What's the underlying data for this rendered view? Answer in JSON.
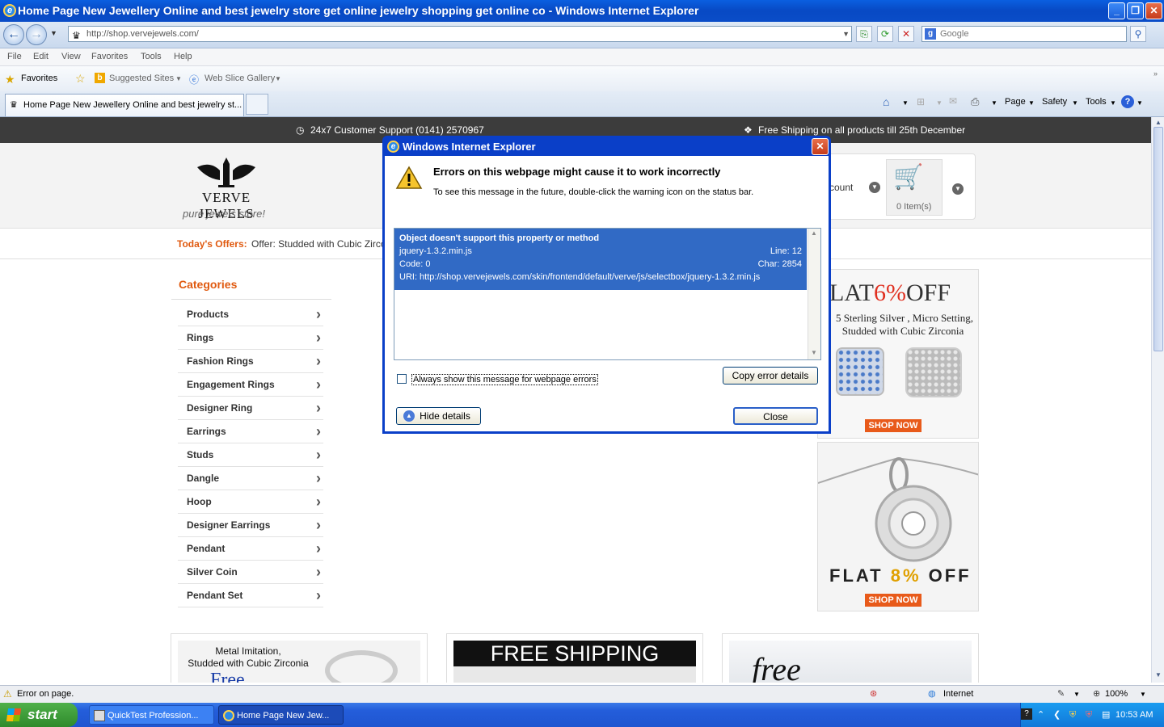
{
  "window": {
    "title": "Home Page New Jewellery Online and best jewelry store get online jewelry shopping get online co - Windows Internet Explorer"
  },
  "address": {
    "url": "http://shop.vervejewels.com/",
    "search_placeholder": "Google"
  },
  "menu": {
    "items": [
      "File",
      "Edit",
      "View",
      "Favorites",
      "Tools",
      "Help"
    ]
  },
  "favorites_bar": {
    "favorites_label": "Favorites",
    "suggested_sites": "Suggested Sites",
    "web_slice_gallery": "Web Slice Gallery"
  },
  "tab": {
    "title": "Home Page New Jewellery Online and best jewelry st..."
  },
  "command_bar": {
    "page": "Page",
    "safety": "Safety",
    "tools": "Tools"
  },
  "site": {
    "support": "24x7 Customer Support (0141) 2570967",
    "shipping": "Free Shipping on all products till 25th December",
    "logo_name": "Verve Jewels",
    "logo_tagline": "pure jewels store!",
    "account_label": "count",
    "cart_items": "0 Item(s)",
    "offers_label": "Today's Offers:",
    "offers_text": "Offer: Studded with Cubic Zirco",
    "categories_title": "Categories",
    "categories": [
      "Products",
      "Rings",
      "Fashion Rings",
      "Engagement Rings",
      "Designer Ring",
      "Earrings",
      "Studs",
      "Dangle",
      "Hoop",
      "Designer Earrings",
      "Pendant",
      "Silver Coin",
      "Pendant Set"
    ],
    "banner1": {
      "headline_pre": "LAT",
      "headline_pct": "6%",
      "headline_post": "OFF",
      "sub1": "5 Sterling Silver , Micro Setting,",
      "sub2": "Studded with Cubic Zirconia",
      "cta": "SHOP NOW"
    },
    "banner2": {
      "headline_pre": "FLAT",
      "headline_pct": "8%",
      "headline_post": "OFF",
      "cta": "SHOP NOW"
    },
    "promo1": {
      "line1": "Metal Imitation,",
      "line2": "Studded with Cubic Zirconia",
      "line3": "Free"
    },
    "promo2": {
      "text": "FREE SHIPPING"
    },
    "promo3": {
      "text": "free"
    }
  },
  "dialog": {
    "title": "Windows Internet Explorer",
    "heading": "Errors on this webpage might cause it to work incorrectly",
    "hint": "To see this message in the future, double-click the warning icon on the status bar.",
    "error": {
      "message": "Object doesn't support this property or method",
      "file": "jquery-1.3.2.min.js",
      "line": "Line: 12",
      "code": "Code: 0",
      "char": "Char: 2854",
      "uri": "URI: http://shop.vervejewels.com/skin/frontend/default/verve/js/selectbox/jquery-1.3.2.min.js"
    },
    "checkbox_label": "Always show this message for webpage errors",
    "copy_button": "Copy error details",
    "hide_button": "Hide details",
    "close_button": "Close"
  },
  "status": {
    "text": "Error on page.",
    "zone": "Internet",
    "zoom": "100%"
  },
  "taskbar": {
    "start": "start",
    "task1": "QuickTest Profession...",
    "task2": "Home Page New Jew...",
    "time": "10:53 AM"
  }
}
